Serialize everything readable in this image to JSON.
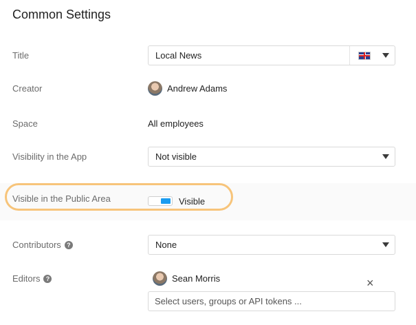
{
  "section": {
    "title": "Common Settings"
  },
  "title_field": {
    "label": "Title",
    "value": "Local News",
    "language_icon": "uk-flag-icon"
  },
  "creator": {
    "label": "Creator",
    "name": "Andrew Adams"
  },
  "space": {
    "label": "Space",
    "value": "All employees"
  },
  "visibility_app": {
    "label": "Visibility in the App",
    "value": "Not visible"
  },
  "public_area": {
    "label": "Visible in the Public Area",
    "toggle_text": "Visible",
    "toggle_on": true,
    "accent_color": "#1a9cf0",
    "highlight_color": "#f7c47a"
  },
  "contributors": {
    "label": "Contributors",
    "value": "None"
  },
  "editors": {
    "label": "Editors",
    "user": "Sean Morris",
    "placeholder": "Select users, groups or API tokens ..."
  }
}
